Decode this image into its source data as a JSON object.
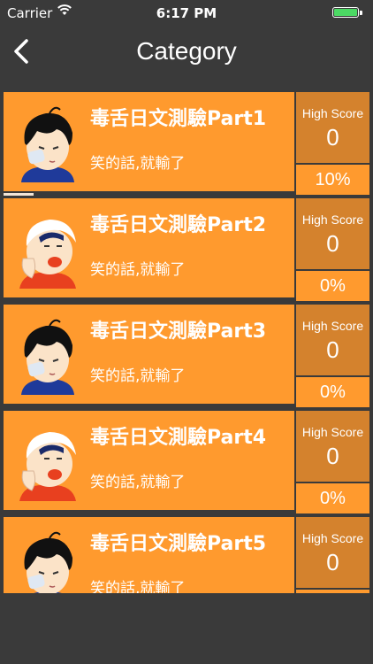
{
  "status_bar": {
    "carrier": "Carrier",
    "time": "6:17 PM",
    "wifi_icon": "wifi-icon",
    "battery_icon": "battery-icon"
  },
  "nav": {
    "title": "Category",
    "back_icon": "chevron-left-icon"
  },
  "colors": {
    "background": "#3a3a3a",
    "card": "#ff9a2e",
    "score_box": "#d4822d",
    "battery": "#4cd964"
  },
  "categories": [
    {
      "title": "毒舌日文測驗Part1",
      "subtitle": "笑的話,就輸了",
      "high_score_label": "High Score",
      "high_score": "0",
      "percent": "10%",
      "avatar": "bandaged-boy-avatar"
    },
    {
      "title": "毒舌日文測驗Part2",
      "subtitle": "笑的話,就輸了",
      "high_score_label": "High Score",
      "high_score": "0",
      "percent": "0%",
      "avatar": "laughing-boy-avatar"
    },
    {
      "title": "毒舌日文測驗Part3",
      "subtitle": "笑的話,就輸了",
      "high_score_label": "High Score",
      "high_score": "0",
      "percent": "0%",
      "avatar": "bandaged-boy-avatar"
    },
    {
      "title": "毒舌日文測驗Part4",
      "subtitle": "笑的話,就輸了",
      "high_score_label": "High Score",
      "high_score": "0",
      "percent": "0%",
      "avatar": "laughing-boy-avatar"
    },
    {
      "title": "毒舌日文測驗Part5",
      "subtitle": "笑的話,就輸了",
      "high_score_label": "High Score",
      "high_score": "0",
      "percent": "",
      "avatar": "bandaged-boy-avatar"
    }
  ],
  "progress_fraction": 0.1
}
